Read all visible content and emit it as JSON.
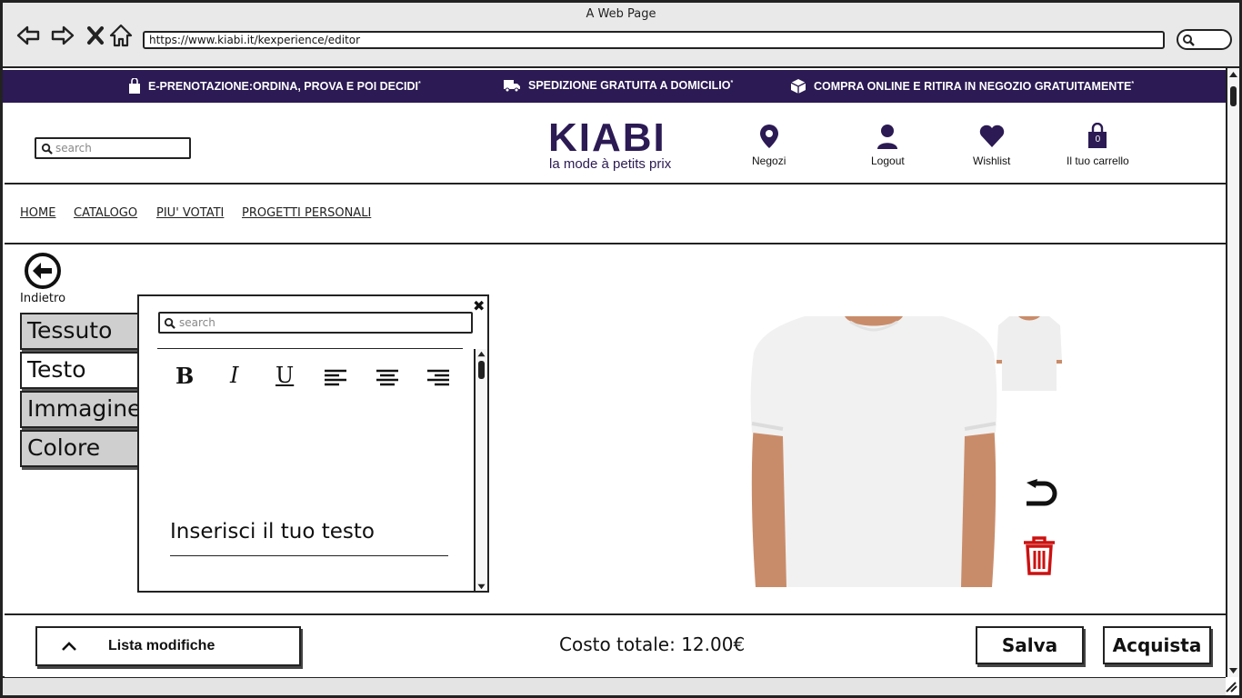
{
  "browser": {
    "title": "A Web Page",
    "url": "https://www.kiabi.it/kexperience/editor"
  },
  "promo": {
    "item1": "E-PRENOTAZIONE:ORDINA, PROVA E POI DECIDI",
    "item2": "SPEDIZIONE GRATUITA A DOMICILIO",
    "item3": "COMPRA ONLINE E RITIRA IN NEGOZIO GRATUITAMENTE",
    "mark": "*"
  },
  "header": {
    "search_placeholder": "search",
    "logo_main": "KIABI",
    "logo_sub": "la mode à petits prix",
    "stores": "Negozi",
    "logout": "Logout",
    "wishlist": "Wishlist",
    "cart": "Il tuo carrello",
    "cart_count": "0"
  },
  "nav": {
    "home": "HOME",
    "catalog": "CATALOGO",
    "top_voted": "PIU' VOTATI",
    "projects": "PROGETTI PERSONALI"
  },
  "editor": {
    "back_label": "Indietro",
    "tabs": [
      "Tessuto",
      "Testo",
      "Immagine",
      "Colore"
    ],
    "active_tab": "Testo"
  },
  "text_panel": {
    "close": "✖",
    "search_placeholder": "search",
    "bold": "B",
    "italic": "I",
    "underline": "U",
    "text_value": "Inserisci il tuo testo"
  },
  "footer": {
    "modifications": "Lista modifiche",
    "total": "Costo totale: 12.00€",
    "save": "Salva",
    "buy": "Acquista"
  },
  "colors": {
    "brand": "#2b1a53",
    "trash": "#cc1111"
  }
}
